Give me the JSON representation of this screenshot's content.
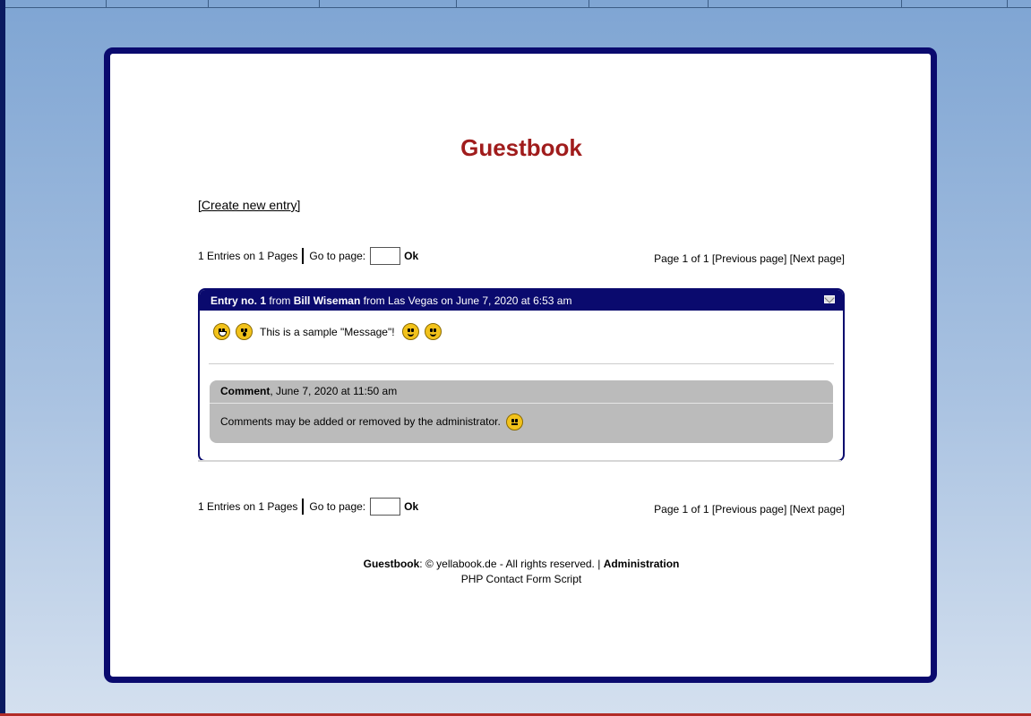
{
  "page": {
    "title": "Guestbook",
    "create_link": "[Create new entry]"
  },
  "pager": {
    "summary": "1 Entries on 1 Pages",
    "goto_label": "Go to page:",
    "goto_value": "",
    "ok_label": "Ok",
    "page_info": "Page 1 of 1",
    "prev_label": "[Previous page]",
    "next_label": "[Next page]"
  },
  "entry": {
    "number_label": "Entry no. 1",
    "from_word": "from",
    "author": "Bill Wiseman",
    "location_text": "from Las Vegas on June 7, 2020 at 6:53 am",
    "message": "This is a sample \"Message\"!",
    "comment_label": "Comment",
    "comment_date": ", June 7, 2020 at 11:50 am",
    "comment_text": "Comments may be added or removed by the administrator."
  },
  "footer": {
    "brand": "Guestbook",
    "copyright": ": © yellabook.de - All rights reserved. | ",
    "admin_link": "Administration",
    "script_link": "PHP Contact Form Script"
  },
  "colors": {
    "title": "#a01c1c",
    "navy": "#0a0a6e",
    "comment_bg": "#bbbbbb"
  }
}
